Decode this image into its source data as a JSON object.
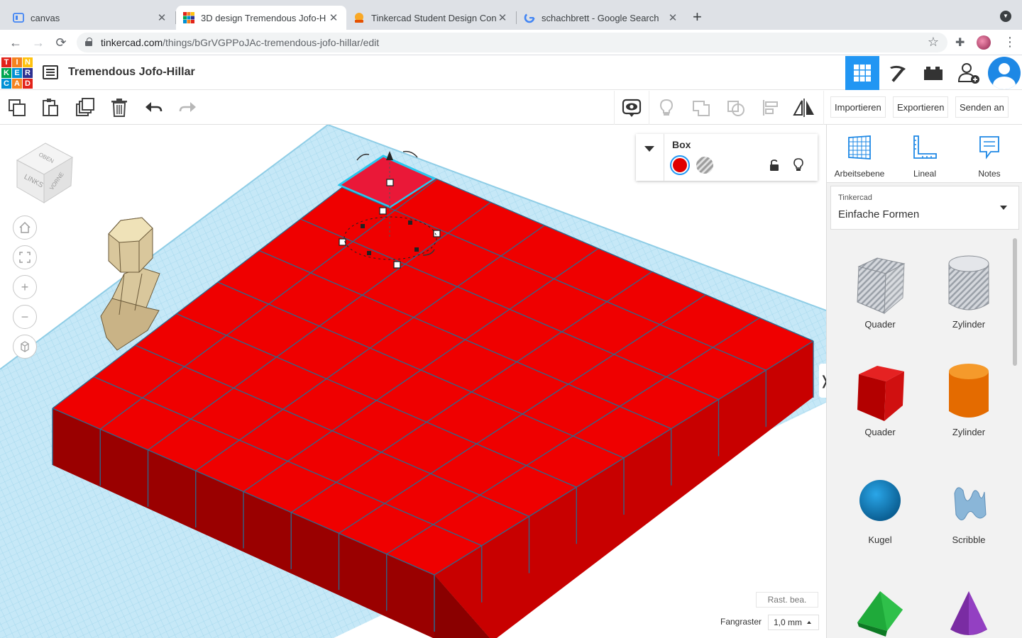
{
  "browser": {
    "tabs": [
      {
        "title": "canvas"
      },
      {
        "title": "3D design Tremendous Jofo-H"
      },
      {
        "title": "Tinkercad Student Design Con"
      },
      {
        "title": "schachbrett - Google Search"
      }
    ],
    "url_host": "tinkercad.com",
    "url_path": "/things/bGrVGPPoJAc-tremendous-jofo-hillar/edit"
  },
  "header": {
    "logo_letters": [
      "T",
      "I",
      "N",
      "K",
      "E",
      "R",
      "C",
      "A",
      "D"
    ],
    "logo_colors": [
      "#e2231a",
      "#f58220",
      "#ffc20e",
      "#00a651",
      "#0091d5",
      "#2e3192",
      "#0091d5",
      "#f58220",
      "#e2231a"
    ],
    "design_title": "Tremendous Jofo-Hillar"
  },
  "toolbar": {
    "import_label": "Importieren",
    "export_label": "Exportieren",
    "send_label": "Senden an"
  },
  "viewcube": {
    "top": "OBEN",
    "left": "LINKS",
    "front": "VORNE"
  },
  "inspector": {
    "title": "Box",
    "color": "#e00000"
  },
  "grid": {
    "edit_label": "Rast. bea.",
    "snap_label": "Fangraster",
    "snap_value": "1,0 mm"
  },
  "panel": {
    "workplane_label": "Arbeitsebene",
    "ruler_label": "Lineal",
    "notes_label": "Notes",
    "library_small": "Tinkercad",
    "library_name": "Einfache Formen",
    "shapes": [
      {
        "label": "Quader",
        "icon": "hole-box-icon"
      },
      {
        "label": "Zylinder",
        "icon": "hole-cylinder-icon"
      },
      {
        "label": "Quader",
        "icon": "box-icon"
      },
      {
        "label": "Zylinder",
        "icon": "cylinder-icon"
      },
      {
        "label": "Kugel",
        "icon": "sphere-icon"
      },
      {
        "label": "Scribble",
        "icon": "scribble-icon"
      }
    ]
  },
  "colors": {
    "accent": "#2196f3",
    "solid_red": "#e00000",
    "workplane": "#c6e8f7"
  }
}
